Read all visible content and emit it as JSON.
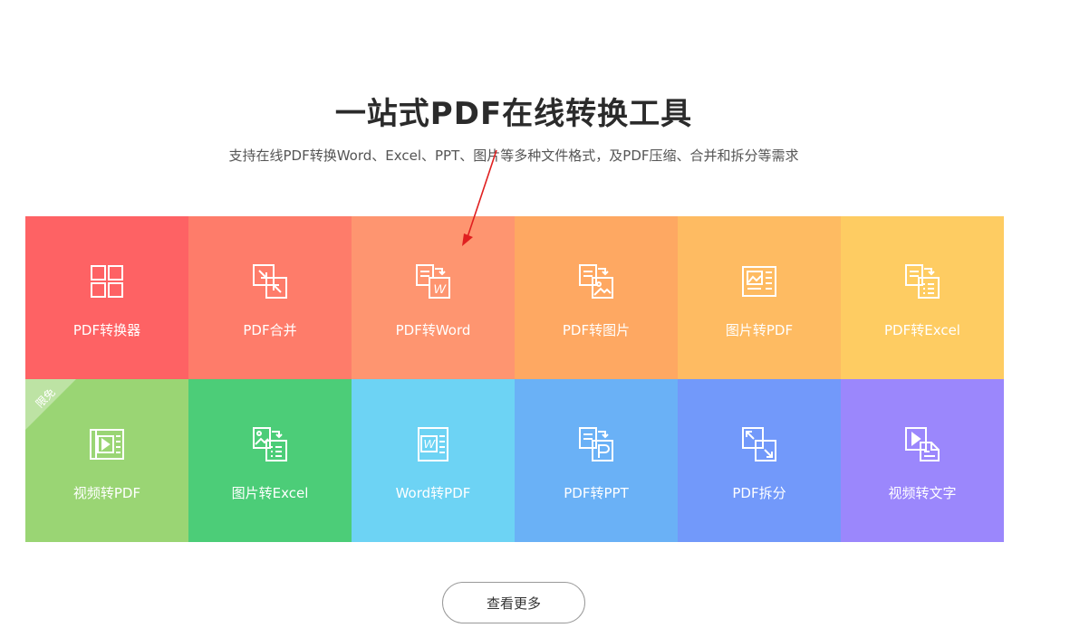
{
  "header": {
    "title": "一站式PDF在线转换工具",
    "subtitle": "支持在线PDF转换Word、Excel、PPT、图片等多种文件格式，及PDF压缩、合并和拆分等需求"
  },
  "tools": [
    {
      "label": "PDF转换器",
      "icon": "grid-four-icon",
      "color": "#fe6264"
    },
    {
      "label": "PDF合并",
      "icon": "merge-arrows-icon",
      "color": "#fe7c6a"
    },
    {
      "label": "PDF转Word",
      "icon": "doc-to-word-icon",
      "color": "#fe9570"
    },
    {
      "label": "PDF转图片",
      "icon": "doc-to-image-icon",
      "color": "#fea862"
    },
    {
      "label": "图片转PDF",
      "icon": "image-to-doc-icon",
      "color": "#febb62"
    },
    {
      "label": "PDF转Excel",
      "icon": "doc-to-excel-icon",
      "color": "#fecc62"
    },
    {
      "label": "视频转PDF",
      "icon": "video-to-doc-icon",
      "color": "#9ad574",
      "badge": "限免"
    },
    {
      "label": "图片转Excel",
      "icon": "image-to-excel-icon",
      "color": "#4ccd78"
    },
    {
      "label": "Word转PDF",
      "icon": "word-to-doc-icon",
      "color": "#6dd3f4"
    },
    {
      "label": "PDF转PPT",
      "icon": "doc-to-ppt-icon",
      "color": "#6ab1f6"
    },
    {
      "label": "PDF拆分",
      "icon": "split-arrows-icon",
      "color": "#7299fa"
    },
    {
      "label": "视频转文字",
      "icon": "video-to-text-icon",
      "color": "#9b87fc"
    }
  ],
  "more_button": {
    "label": "查看更多"
  },
  "annotation": {
    "arrow_color": "#e02020"
  }
}
